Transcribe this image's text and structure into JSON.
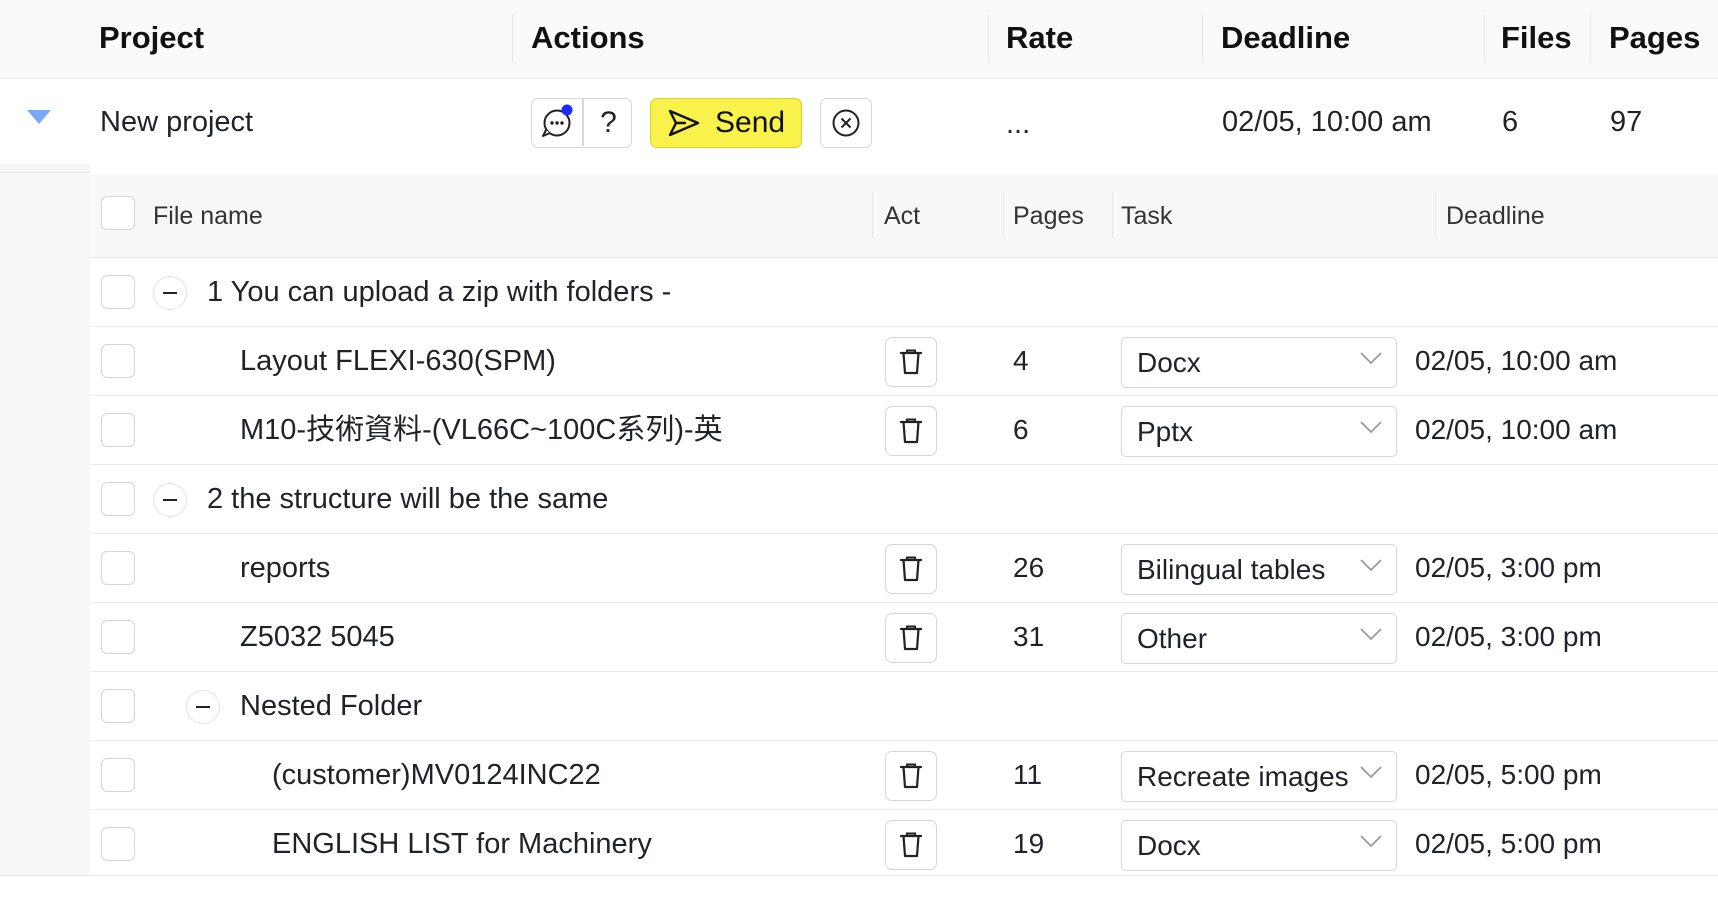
{
  "project_table": {
    "columns": {
      "project": "Project",
      "actions": "Actions",
      "rate": "Rate",
      "deadline": "Deadline",
      "files": "Files",
      "pages": "Pages"
    },
    "project": {
      "name": "New project",
      "help_label": "?",
      "send_label": "Send",
      "rate": "...",
      "deadline": "02/05, 10:00 am",
      "files": "6",
      "pages": "97"
    }
  },
  "file_table": {
    "columns": {
      "file_name": "File name",
      "act": "Act",
      "pages": "Pages",
      "task": "Task",
      "deadline": "Deadline"
    },
    "rows": [
      {
        "kind": "folder",
        "name": "1 You can upload a zip with folders -"
      },
      {
        "kind": "file",
        "name": "Layout FLEXI-630(SPM)",
        "pages": "4",
        "task": "Docx",
        "deadline": "02/05, 10:00 am"
      },
      {
        "kind": "file",
        "name": "M10-技術資料-(VL66C~100C系列)-英",
        "pages": "6",
        "task": "Pptx",
        "deadline": "02/05, 10:00 am"
      },
      {
        "kind": "folder",
        "name": "2 the structure will be the same"
      },
      {
        "kind": "file",
        "name": "reports",
        "pages": "26",
        "task": "Bilingual tables",
        "deadline": "02/05, 3:00 pm"
      },
      {
        "kind": "file",
        "name": "Z5032 5045",
        "pages": "31",
        "task": "Other",
        "deadline": "02/05, 3:00 pm"
      },
      {
        "kind": "folder",
        "name": "Nested Folder"
      },
      {
        "kind": "file",
        "name": "(customer)MV0124INC22",
        "pages": "11",
        "task": "Recreate images",
        "deadline": "02/05, 5:00 pm"
      },
      {
        "kind": "file",
        "name": "ENGLISH LIST for Machinery",
        "pages": "19",
        "task": "Docx",
        "deadline": "02/05, 5:00 pm"
      }
    ]
  },
  "icons": {
    "expand": "triangle-down-icon",
    "chat": "chat-bubble-icon",
    "send": "send-arrow-icon",
    "cancel": "close-circle-icon",
    "delete": "trash-icon",
    "collapse": "minus-circle-icon",
    "dropdown": "chevron-down-icon"
  },
  "colors": {
    "send_button": "#f8f24a",
    "notification_dot": "#1a2bff",
    "expand_triangle": "#7aa8f5"
  }
}
